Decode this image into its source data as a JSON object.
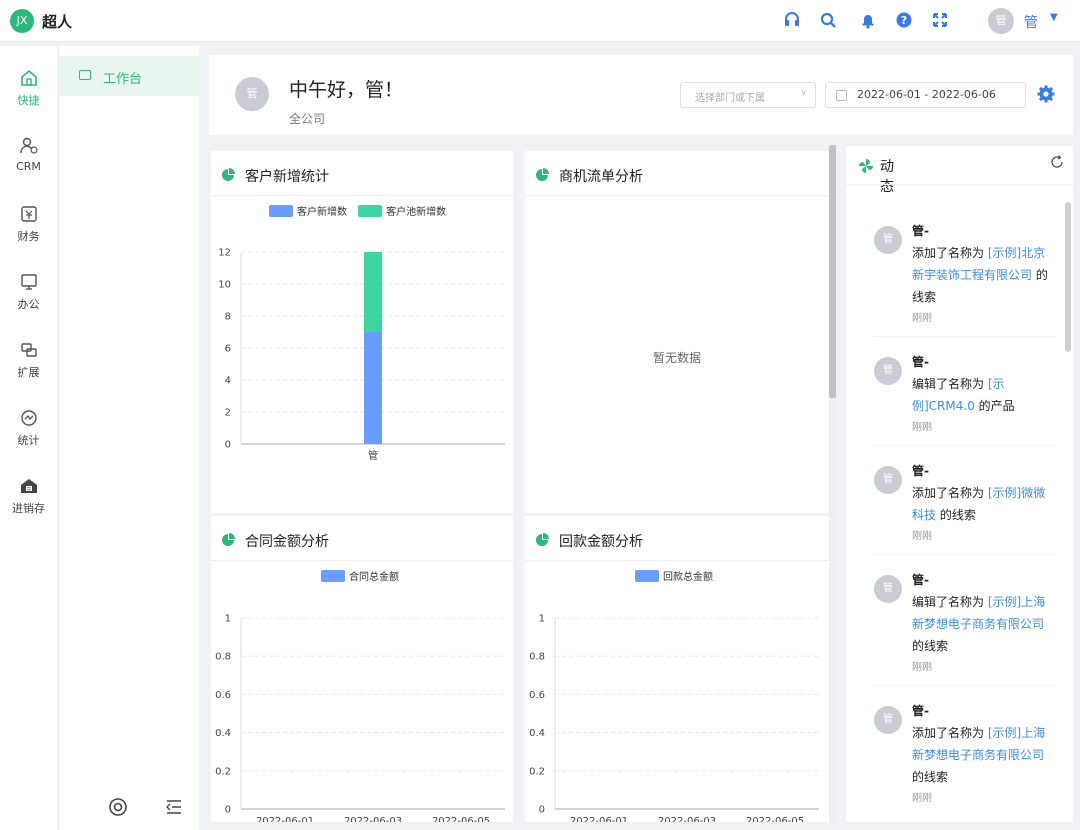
{
  "app": {
    "logo_text": "JX",
    "name": "超人"
  },
  "topbar": {
    "icons": [
      "headset-icon",
      "search-icon",
      "bell-icon",
      "help-icon",
      "fullscreen-icon"
    ],
    "avatar_text": "管",
    "user_name": "管",
    "accent": "#3a7be0"
  },
  "rail": {
    "items": [
      {
        "label": "快捷",
        "icon": "home-icon",
        "active": true
      },
      {
        "label": "CRM",
        "icon": "crm-icon",
        "active": false
      },
      {
        "label": "财务",
        "icon": "finance-icon",
        "active": false
      },
      {
        "label": "办公",
        "icon": "monitor-icon",
        "active": false
      },
      {
        "label": "扩展",
        "icon": "extension-icon",
        "active": false
      },
      {
        "label": "统计",
        "icon": "stats-icon",
        "active": false
      },
      {
        "label": "进销存",
        "icon": "store-icon",
        "active": false
      }
    ]
  },
  "subnav": {
    "items": [
      {
        "label": "工作台",
        "icon": "workbench-icon"
      }
    ]
  },
  "header": {
    "avatar_text": "管",
    "greeting": "中午好，管！",
    "scope": "全公司",
    "dept_placeholder": "选择部门或下属",
    "date_range": "2022-06-01  -  2022-06-06"
  },
  "cards": {
    "new_customers": {
      "title": "客户新增统计"
    },
    "opportunity": {
      "title": "商机流单分析",
      "empty": "暂无数据"
    },
    "contract": {
      "title": "合同金额分析"
    },
    "payment": {
      "title": "回款金额分析"
    }
  },
  "chart_data": [
    {
      "type": "bar",
      "stacked": true,
      "categories": [
        "管"
      ],
      "series": [
        {
          "name": "客户新增数",
          "values": [
            7
          ],
          "color": "#6a9cf9"
        },
        {
          "name": "客户池新增数",
          "values": [
            5
          ],
          "color": "#3dd6a1"
        }
      ],
      "ylim": [
        0,
        12
      ],
      "yticks": [
        "0",
        "2",
        "4",
        "6",
        "8",
        "10",
        "12"
      ],
      "legend": "top-center",
      "grid": true
    },
    {
      "type": "bar",
      "categories": [
        "2022-06-01",
        "2022-06-03",
        "2022-06-05"
      ],
      "series": [
        {
          "name": "合同总金额",
          "values": [
            0,
            0,
            0
          ],
          "color": "#6a9cf9"
        }
      ],
      "ylim": [
        0,
        1
      ],
      "yticks": [
        "0",
        "0.2",
        "0.4",
        "0.6",
        "0.8",
        "1"
      ],
      "legend": "top-center",
      "grid": true
    },
    {
      "type": "bar",
      "categories": [
        "2022-06-01",
        "2022-06-03",
        "2022-06-05"
      ],
      "series": [
        {
          "name": "回款总金额",
          "values": [
            0,
            0,
            0
          ],
          "color": "#6a9cf9"
        }
      ],
      "ylim": [
        0,
        1
      ],
      "yticks": [
        "0",
        "0.2",
        "0.4",
        "0.6",
        "0.8",
        "1"
      ],
      "legend": "top-center",
      "grid": true
    }
  ],
  "activity": {
    "title": "动态",
    "items": [
      {
        "avatar": "管",
        "user": "管-",
        "pre": "添加了名称为 ",
        "link": "[示例]北京新宇装饰工程有限公司",
        "post": " 的线索",
        "time": "刚刚"
      },
      {
        "avatar": "管",
        "user": "管-",
        "pre": "编辑了名称为 ",
        "link": "[示例]CRM4.0",
        "post": " 的产品",
        "time": "刚刚"
      },
      {
        "avatar": "管",
        "user": "管-",
        "pre": "添加了名称为 ",
        "link": "[示例]微微科技",
        "post": " 的线索",
        "time": "刚刚"
      },
      {
        "avatar": "管",
        "user": "管-",
        "pre": "编辑了名称为 ",
        "link": "[示例]上海新梦想电子商务有限公司",
        "post": " 的线索",
        "time": "刚刚"
      },
      {
        "avatar": "管",
        "user": "管-",
        "pre": "添加了名称为 ",
        "link": "[示例]上海新梦想电子商务有限公司",
        "post": " 的线索",
        "time": "刚刚"
      }
    ]
  },
  "colors": {
    "primary": "#2fb87a",
    "link": "#3a8ee6"
  }
}
